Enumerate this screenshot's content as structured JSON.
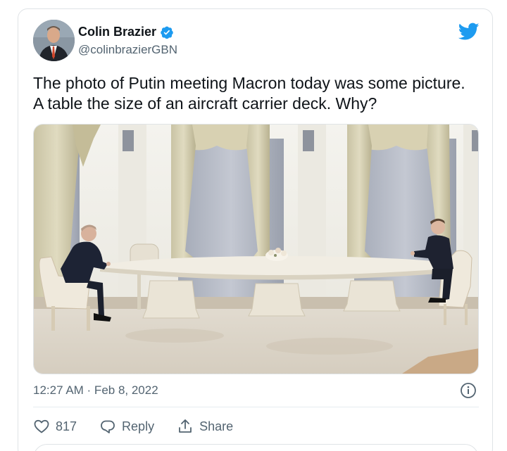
{
  "tweet": {
    "author_name": "Colin Brazier",
    "author_handle": "@colinbrazierGBN",
    "text": "The photo of Putin meeting Macron today was some picture. A table the size of an aircraft carrier deck. Why?",
    "timestamp": "12:27 AM · Feb 8, 2022"
  },
  "actions": {
    "like_count": "817",
    "reply_label": "Reply",
    "share_label": "Share"
  },
  "icons": {
    "verified": "verified-badge-icon",
    "logo": "twitter-bird-icon",
    "info": "info-icon",
    "like": "heart-icon",
    "reply": "speech-bubble-icon",
    "share": "share-upload-icon"
  },
  "colors": {
    "twitter_blue": "#1d9bf0",
    "text_primary": "#0f1419",
    "text_secondary": "#536471",
    "border": "#dfe3e6"
  }
}
